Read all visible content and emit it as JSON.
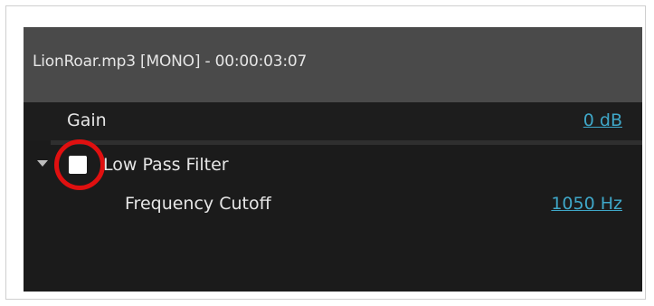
{
  "track": {
    "title": "LionRoar.mp3  [MONO] - 00:00:03:07"
  },
  "properties": {
    "gain": {
      "label": "Gain",
      "value": "0 dB"
    },
    "low_pass_filter": {
      "label": "Low Pass Filter",
      "enabled": false,
      "expanded": true,
      "frequency_cutoff": {
        "label": "Frequency Cutoff",
        "value": "1050 Hz"
      }
    }
  },
  "colors": {
    "header_bg": "#4a4a4a",
    "panel_bg": "#1b1b1b",
    "link": "#3fa7c8",
    "highlight_ring": "#e01010"
  },
  "icons": {
    "expand": "triangle-down",
    "checkbox": "unchecked-box"
  }
}
